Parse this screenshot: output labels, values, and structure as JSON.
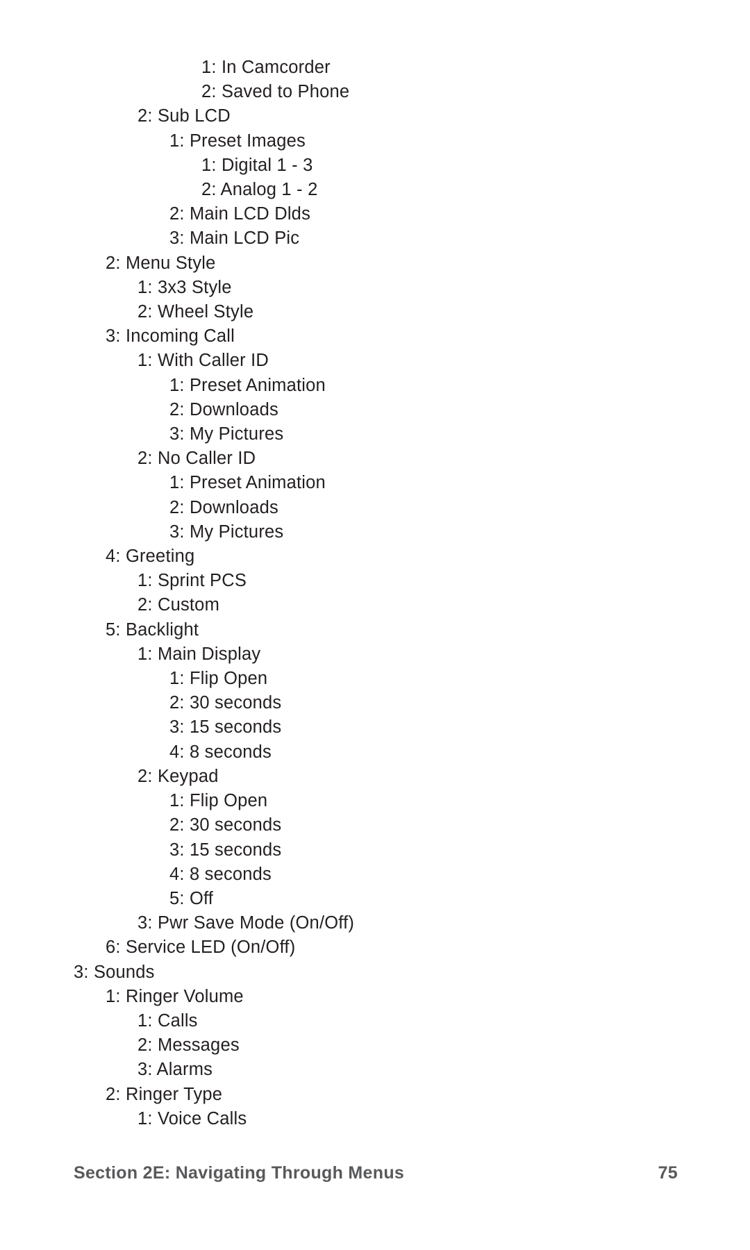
{
  "footer": {
    "section": "Section 2E: Navigating Through Menus",
    "page": "75"
  },
  "lines": [
    {
      "level": 4,
      "text": "1: In Camcorder"
    },
    {
      "level": 4,
      "text": "2: Saved to Phone"
    },
    {
      "level": 2,
      "text": "2: Sub LCD"
    },
    {
      "level": 3,
      "text": "1: Preset Images"
    },
    {
      "level": 4,
      "text": "1: Digital 1 - 3"
    },
    {
      "level": 4,
      "text": "2: Analog 1 - 2"
    },
    {
      "level": 3,
      "text": "2: Main LCD Dlds"
    },
    {
      "level": 3,
      "text": "3: Main LCD Pic"
    },
    {
      "level": 1,
      "text": "2: Menu Style"
    },
    {
      "level": 2,
      "text": "1: 3x3 Style"
    },
    {
      "level": 2,
      "text": "2: Wheel Style"
    },
    {
      "level": 1,
      "text": "3: Incoming Call"
    },
    {
      "level": 2,
      "text": "1: With Caller ID"
    },
    {
      "level": 3,
      "text": "1: Preset Animation"
    },
    {
      "level": 3,
      "text": "2: Downloads"
    },
    {
      "level": 3,
      "text": "3: My Pictures"
    },
    {
      "level": 2,
      "text": "2: No Caller ID"
    },
    {
      "level": 3,
      "text": "1: Preset Animation"
    },
    {
      "level": 3,
      "text": "2: Downloads"
    },
    {
      "level": 3,
      "text": "3: My Pictures"
    },
    {
      "level": 1,
      "text": "4: Greeting"
    },
    {
      "level": 2,
      "text": "1: Sprint PCS"
    },
    {
      "level": 2,
      "text": "2: Custom"
    },
    {
      "level": 1,
      "text": "5: Backlight"
    },
    {
      "level": 2,
      "text": "1: Main Display"
    },
    {
      "level": 3,
      "text": "1: Flip Open"
    },
    {
      "level": 3,
      "text": "2: 30 seconds"
    },
    {
      "level": 3,
      "text": "3: 15 seconds"
    },
    {
      "level": 3,
      "text": "4: 8 seconds"
    },
    {
      "level": 2,
      "text": "2: Keypad"
    },
    {
      "level": 3,
      "text": "1: Flip Open"
    },
    {
      "level": 3,
      "text": "2: 30 seconds"
    },
    {
      "level": 3,
      "text": "3: 15 seconds"
    },
    {
      "level": 3,
      "text": "4: 8 seconds"
    },
    {
      "level": 3,
      "text": "5: Off"
    },
    {
      "level": 2,
      "text": "3: Pwr Save Mode (On/Off)"
    },
    {
      "level": 1,
      "text": "6: Service LED (On/Off)"
    },
    {
      "level": 0,
      "text": "3: Sounds"
    },
    {
      "level": 1,
      "text": "1: Ringer Volume"
    },
    {
      "level": 2,
      "text": "1: Calls"
    },
    {
      "level": 2,
      "text": "2: Messages"
    },
    {
      "level": 2,
      "text": "3: Alarms"
    },
    {
      "level": 1,
      "text": "2: Ringer Type"
    },
    {
      "level": 2,
      "text": "1: Voice Calls"
    }
  ]
}
